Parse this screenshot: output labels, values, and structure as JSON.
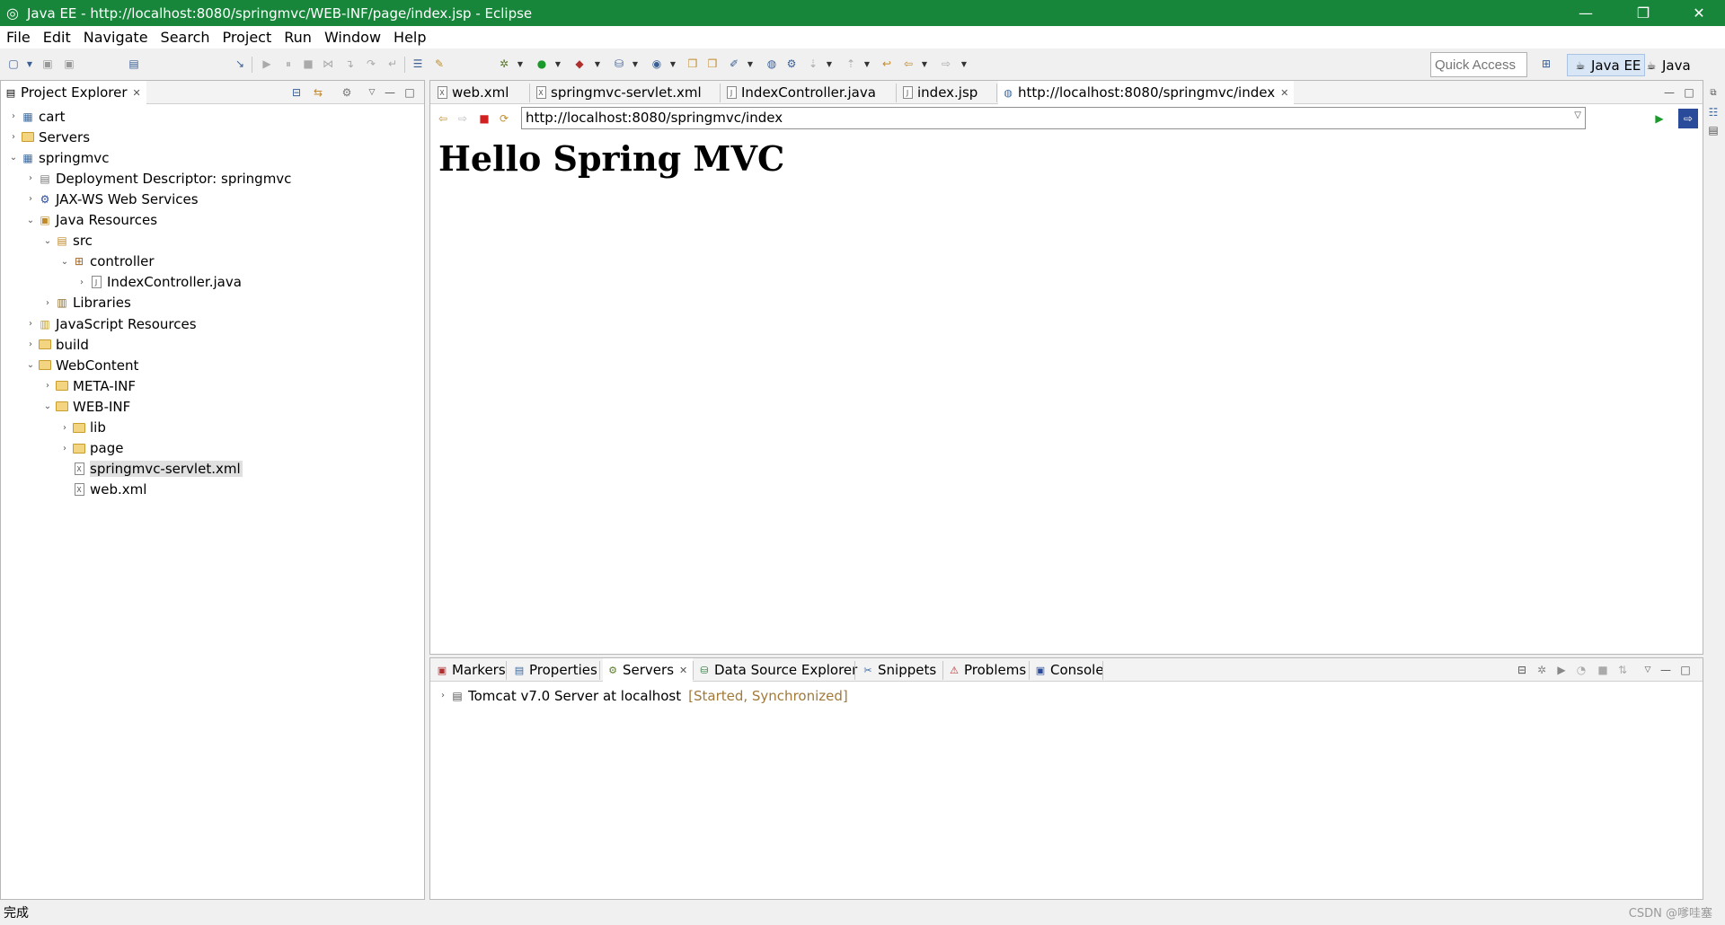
{
  "window": {
    "title": "Java EE - http://localhost:8080/springmvc/WEB-INF/page/index.jsp - Eclipse",
    "accent": "#17863a"
  },
  "menu": [
    "File",
    "Edit",
    "Navigate",
    "Search",
    "Project",
    "Run",
    "Window",
    "Help"
  ],
  "toolbar": {
    "quick_access_placeholder": "Quick Access",
    "perspectives": [
      "Java EE",
      "Java"
    ]
  },
  "project_explorer": {
    "title": "Project Explorer",
    "tree": [
      {
        "label": "cart",
        "depth": 0,
        "state": "collapsed",
        "icon": "project-icon"
      },
      {
        "label": "Servers",
        "depth": 0,
        "state": "collapsed",
        "icon": "folder-icon"
      },
      {
        "label": "springmvc",
        "depth": 0,
        "state": "expanded",
        "icon": "project-icon"
      },
      {
        "label": "Deployment Descriptor: springmvc",
        "depth": 1,
        "state": "collapsed",
        "icon": "descriptor-icon"
      },
      {
        "label": "JAX-WS Web Services",
        "depth": 1,
        "state": "collapsed",
        "icon": "webservice-icon"
      },
      {
        "label": "Java Resources",
        "depth": 1,
        "state": "expanded",
        "icon": "java-resources-icon"
      },
      {
        "label": "src",
        "depth": 2,
        "state": "expanded",
        "icon": "source-folder-icon"
      },
      {
        "label": "controller",
        "depth": 3,
        "state": "expanded",
        "icon": "package-icon"
      },
      {
        "label": "IndexController.java",
        "depth": 4,
        "state": "collapsed",
        "icon": "java-file-icon"
      },
      {
        "label": "Libraries",
        "depth": 2,
        "state": "collapsed",
        "icon": "library-icon"
      },
      {
        "label": "JavaScript Resources",
        "depth": 1,
        "state": "collapsed",
        "icon": "js-resources-icon"
      },
      {
        "label": "build",
        "depth": 1,
        "state": "collapsed",
        "icon": "folder-icon"
      },
      {
        "label": "WebContent",
        "depth": 1,
        "state": "expanded",
        "icon": "folder-icon"
      },
      {
        "label": "META-INF",
        "depth": 2,
        "state": "collapsed",
        "icon": "folder-icon"
      },
      {
        "label": "WEB-INF",
        "depth": 2,
        "state": "expanded",
        "icon": "folder-icon"
      },
      {
        "label": "lib",
        "depth": 3,
        "state": "collapsed",
        "icon": "folder-icon"
      },
      {
        "label": "page",
        "depth": 3,
        "state": "collapsed",
        "icon": "folder-icon"
      },
      {
        "label": "springmvc-servlet.xml",
        "depth": 3,
        "state": "leaf",
        "icon": "xml-file-icon",
        "selected": true
      },
      {
        "label": "web.xml",
        "depth": 3,
        "state": "leaf",
        "icon": "xml-file-icon"
      }
    ]
  },
  "editor_tabs": [
    {
      "label": "web.xml",
      "icon": "xml-file-icon"
    },
    {
      "label": "springmvc-servlet.xml",
      "icon": "xml-file-icon"
    },
    {
      "label": "IndexController.java",
      "icon": "java-file-icon"
    },
    {
      "label": "index.jsp",
      "icon": "jsp-file-icon"
    },
    {
      "label": "http://localhost:8080/springmvc/index",
      "icon": "globe-icon",
      "active": true
    }
  ],
  "browser": {
    "url": "http://localhost:8080/springmvc/index",
    "heading": "Hello Spring MVC"
  },
  "bottom_tabs": [
    {
      "label": "Markers",
      "icon": "markers-icon"
    },
    {
      "label": "Properties",
      "icon": "properties-icon"
    },
    {
      "label": "Servers",
      "icon": "servers-icon",
      "active": true
    },
    {
      "label": "Data Source Explorer",
      "icon": "datasource-icon"
    },
    {
      "label": "Snippets",
      "icon": "snippets-icon"
    },
    {
      "label": "Problems",
      "icon": "problems-icon"
    },
    {
      "label": "Console",
      "icon": "console-icon"
    }
  ],
  "servers": [
    {
      "name": "Tomcat v7.0 Server at localhost",
      "status": "[Started, Synchronized]"
    }
  ],
  "status_bar": {
    "text": "完成",
    "watermark": "CSDN @嗲哇塞"
  }
}
